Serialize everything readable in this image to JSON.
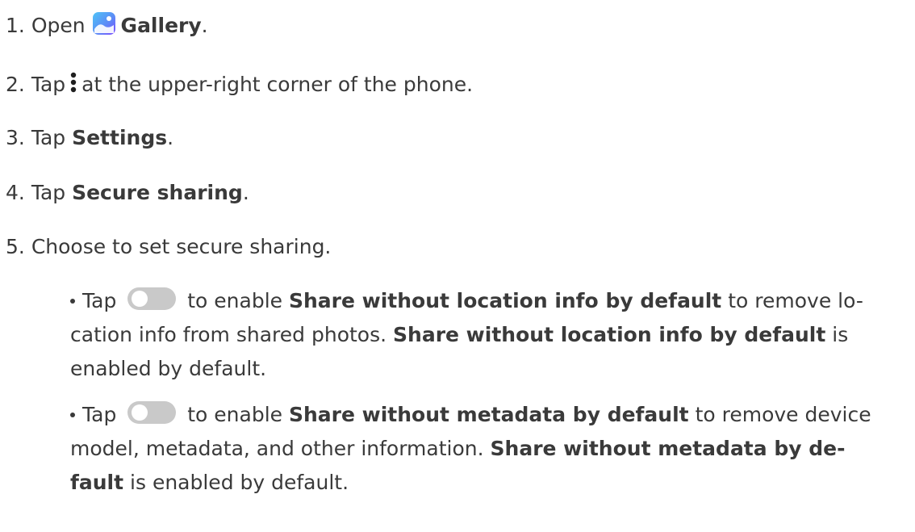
{
  "steps": [
    {
      "num": "1.",
      "pre": "Open",
      "bold": "Gallery",
      "post": "."
    },
    {
      "num": "2.",
      "pre": "Tap",
      "post": "at the upper-right corner of the phone."
    },
    {
      "num": "3.",
      "pre": "Tap",
      "bold": "Settings",
      "post": "."
    },
    {
      "num": "4.",
      "pre": "Tap",
      "bold": "Secure sharing",
      "post": "."
    },
    {
      "num": "5.",
      "text": "Choose to set secure sharing."
    }
  ],
  "bullets": [
    {
      "pre": "Tap",
      "mid1": "to enable",
      "bold1": "Share without location info by default",
      "mid2": "to remove lo-",
      "line2_pre": "cation info from shared photos.",
      "bold2": "Share without location info by default",
      "line2_post": "is",
      "line3": "enabled by default."
    },
    {
      "pre": "Tap",
      "mid1": "to enable",
      "bold1": "Share without metadata by default",
      "mid2": "to remove device",
      "line2_pre": "model, metadata, and other information.",
      "bold2a": "Share without metadata by de-",
      "bold2b": "fault",
      "line3_post": "is enabled by default."
    }
  ],
  "icons": {
    "gallery": "gallery-app-icon",
    "more": "more-options-vertical-dots-icon",
    "toggle": "toggle-switch-off-icon"
  },
  "colors": {
    "text": "#3a3a3a",
    "toggle": "#c9c9c9",
    "gallery_top": "#4fc3f7",
    "gallery_bottom": "#7c4dff"
  }
}
